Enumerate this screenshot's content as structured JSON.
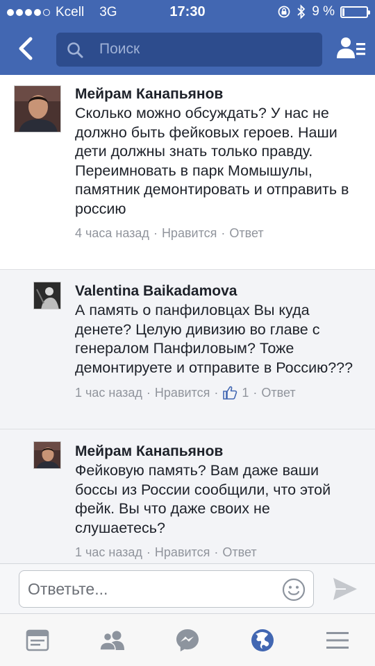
{
  "status_bar": {
    "carrier": "Kcell",
    "network": "3G",
    "time": "17:30",
    "battery": "9 %",
    "battery_level": 0.09,
    "signal_bars": 4
  },
  "header": {
    "search_placeholder": "Поиск",
    "back_icon": "chevron-left-icon",
    "friends_icon": "friend-requests-icon"
  },
  "colors": {
    "brand_blue": "#4267b2",
    "search_bg": "#2d4c8d",
    "link_blue": "#4267b2",
    "meta_gray": "#90949c"
  },
  "comments": [
    {
      "author": "Мейрам Канапьянов",
      "text": "Сколько можно обсуждать? У нас не должно быть фейковых героев. Наши дети должны знать только правду. Переимновать в парк Момышулы, памятник демонтировать и отправить в россию",
      "time": "4 часа назад",
      "like": "Нравится",
      "reply": "Ответ"
    },
    {
      "author": "Valentina Baikadamova",
      "text": "А память о панфиловцах Вы куда денете? Целую дивизию во главе с генералом Панфиловым? Тоже демонтируете и отправите в Россию???",
      "time": "1 час назад",
      "like": "Нравится",
      "like_count": "1",
      "reply": "Ответ"
    },
    {
      "author": "Мейрам Канапьянов",
      "text": "Фейковую память? Вам даже ваши боссы из России сообщили, что этой фейк. Вы что даже своих не слушаетесь?",
      "time": "1 час назад",
      "like": "Нравится",
      "reply": "Ответ"
    }
  ],
  "reply_bar": {
    "placeholder": "Ответьте...",
    "emoji_icon": "emoji-icon",
    "send_icon": "send-icon"
  },
  "tabbar": {
    "tabs": [
      "news-feed-icon",
      "friends-icon",
      "messenger-icon",
      "notifications-globe-icon",
      "menu-icon"
    ],
    "active": "notifications-globe-icon"
  }
}
